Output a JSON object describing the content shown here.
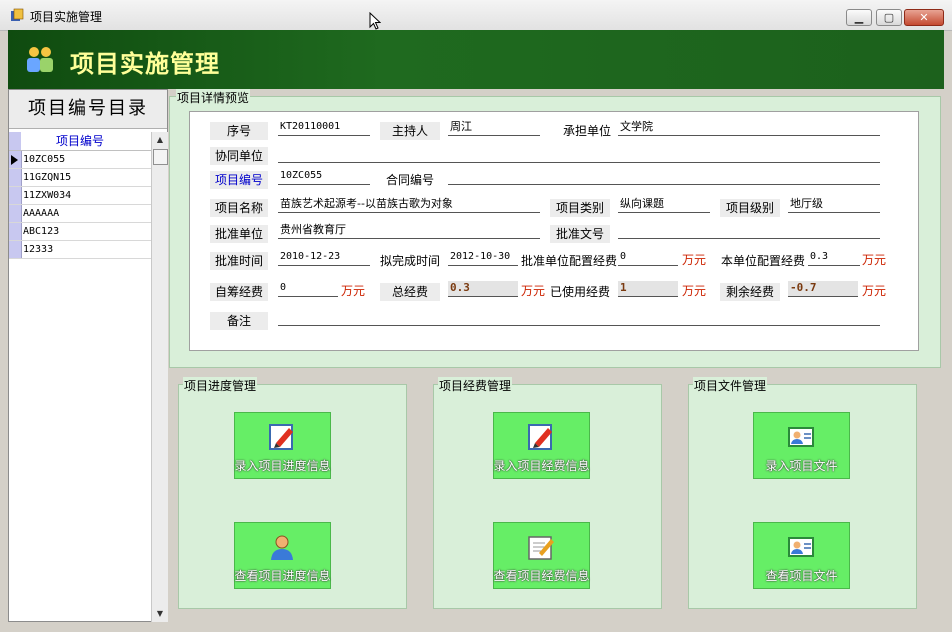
{
  "window": {
    "title": "项目实施管理"
  },
  "banner": {
    "title": "项目实施管理"
  },
  "left_panel": {
    "title": "项目编号目录",
    "column_header": "项目编号",
    "rows": [
      "10ZC055",
      "11GZQN15",
      "11ZXW034",
      "AAAAAA",
      "ABC123",
      "12333"
    ],
    "selected_index": 0
  },
  "preview": {
    "legend": "项目详情预览",
    "fields": {
      "seq_label": "序号",
      "seq_value": "KT20110001",
      "host_label": "主持人",
      "host_value": "周江",
      "undertaker_label": "承担单位",
      "undertaker_value": "文学院",
      "coop_label": "协同单位",
      "coop_value": "",
      "projno_label": "项目编号",
      "projno_value": "10ZC055",
      "contract_label": "合同编号",
      "contract_value": "",
      "name_label": "项目名称",
      "name_value": "苗族艺术起源考--以苗族古歌为对象",
      "category_label": "项目类别",
      "category_value": "纵向课题",
      "level_label": "项目级别",
      "level_value": "地厅级",
      "approver_label": "批准单位",
      "approver_value": "贵州省教育厅",
      "docno_label": "批准文号",
      "docno_value": "",
      "approve_time_label": "批准时间",
      "approve_time_value": "2010-12-23",
      "finish_time_label": "拟完成时间",
      "finish_time_value": "2012-10-30",
      "approve_fund_label": "批准单位配置经费",
      "approve_fund_value": "0",
      "local_fund_label": "本单位配置经费",
      "local_fund_value": "0.3",
      "self_fund_label": "自筹经费",
      "self_fund_value": "0",
      "total_fund_label": "总经费",
      "total_fund_value": "0.3",
      "used_fund_label": "已使用经费",
      "used_fund_value": "1",
      "remain_fund_label": "剩余经费",
      "remain_fund_value": "-0.7",
      "note_label": "备注",
      "note_value": "",
      "unit": "万元"
    }
  },
  "groups": {
    "progress": {
      "legend": "项目进度管理",
      "btn1": "录入项目进度信息",
      "btn2": "查看项目进度信息"
    },
    "funding": {
      "legend": "项目经费管理",
      "btn1": "录入项目经费信息",
      "btn2": "查看项目经费信息"
    },
    "files": {
      "legend": "项目文件管理",
      "btn1": "录入项目文件",
      "btn2": "查看项目文件"
    }
  },
  "colors": {
    "banner_bg": "#1c611c",
    "banner_text": "#ffff99",
    "panel_bg": "#d9efd9",
    "button_bg": "#66ee66",
    "unit_red": "#cc2200"
  }
}
